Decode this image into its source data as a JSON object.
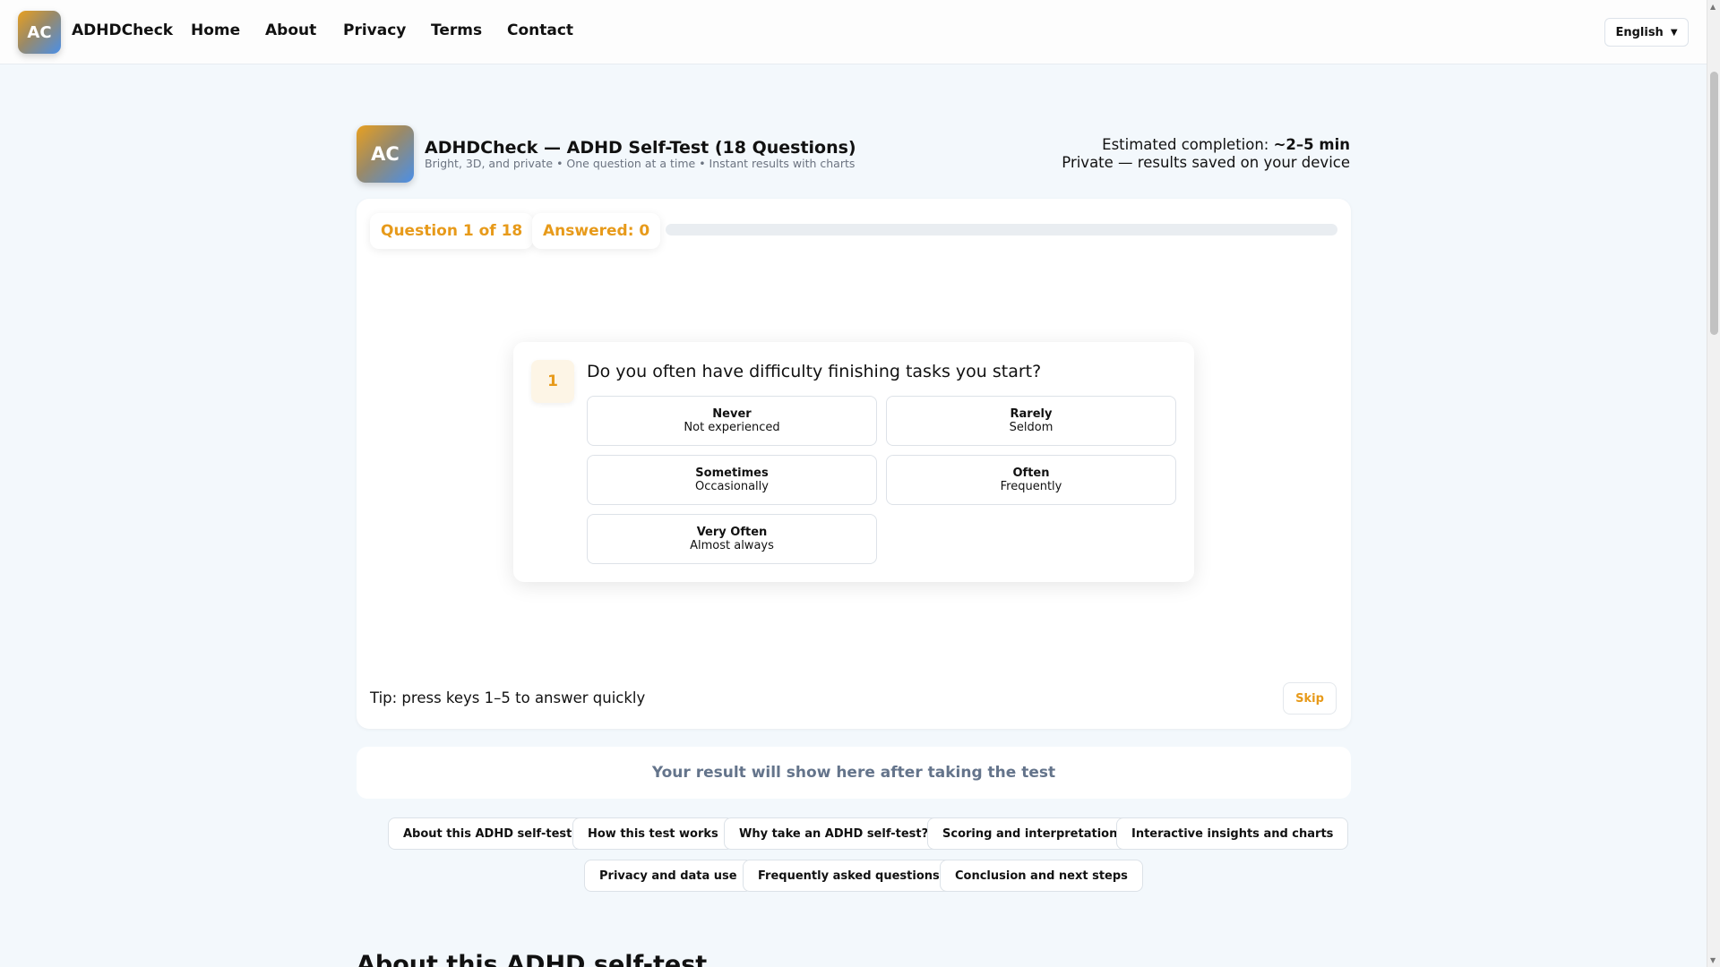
{
  "nav": {
    "logo": "AC",
    "brand": "ADHDCheck",
    "links": [
      "Home",
      "About",
      "Privacy",
      "Terms",
      "Contact"
    ],
    "language": "English",
    "language_icon": "caret-down-icon"
  },
  "header": {
    "logo": "AC",
    "title": "ADHDCheck — ADHD Self-Test (18 Questions)",
    "subtitle": "Bright, 3D, and private • One question at a time • Instant results with charts",
    "estimate_label": "Estimated completion:",
    "estimate_value": "~2–5 min",
    "privacy_note": "Private — results saved on your device"
  },
  "quiz": {
    "question_counter": "Question 1 of 18",
    "answered": "Answered: 0",
    "progress_fraction": 0,
    "question_number": "1",
    "question_text": "Do you often have difficulty finishing tasks you start?",
    "options": [
      {
        "label": "Never",
        "desc": "Not experienced"
      },
      {
        "label": "Rarely",
        "desc": "Seldom"
      },
      {
        "label": "Sometimes",
        "desc": "Occasionally"
      },
      {
        "label": "Often",
        "desc": "Frequently"
      },
      {
        "label": "Very Often",
        "desc": "Almost always"
      }
    ],
    "tip": "Tip: press keys 1–5 to answer quickly",
    "skip": "Skip"
  },
  "result_placeholder": "Your result will show here after taking the test",
  "section_links": [
    "About this ADHD self-test",
    "How this test works",
    "Why take an ADHD self-test?",
    "Scoring and interpretation",
    "Interactive insights and charts",
    "Privacy and data use",
    "Frequently asked questions",
    "Conclusion and next steps"
  ],
  "section_heading": "About this ADHD self-test",
  "colors": {
    "accent": "#e79a1a",
    "background": "#f3f8fc",
    "muted": "#64748b"
  }
}
